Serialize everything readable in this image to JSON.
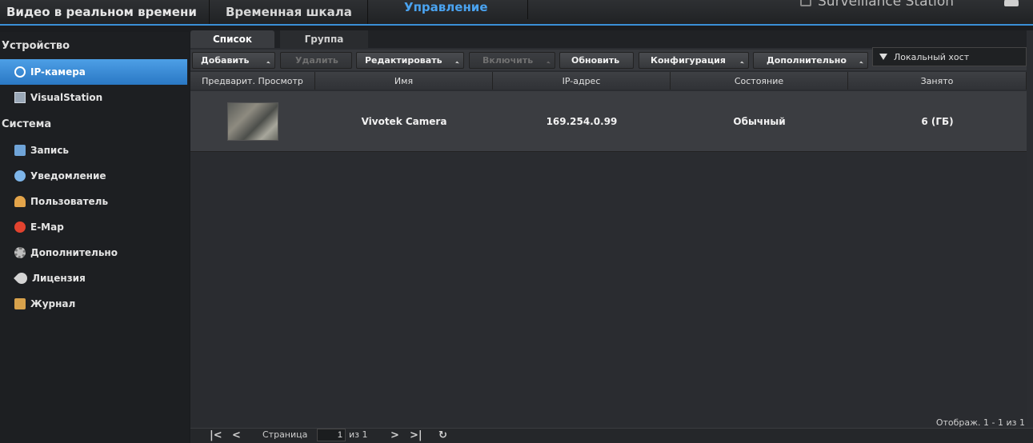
{
  "top_nav": {
    "live_view": "Видео в реальном времени",
    "timeline": "Временная шкала",
    "management": "Управление",
    "brand": "Surveillance Station"
  },
  "sidebar": {
    "device_section": "Устройство",
    "system_section": "Система",
    "device_items": [
      {
        "label": "IP-камера",
        "icon": "camera-icon"
      },
      {
        "label": "VisualStation",
        "icon": "visualstation-icon"
      }
    ],
    "system_items": [
      {
        "label": "Запись",
        "icon": "recording-icon"
      },
      {
        "label": "Уведомление",
        "icon": "notification-icon"
      },
      {
        "label": "Пользователь",
        "icon": "user-icon"
      },
      {
        "label": "E-Map",
        "icon": "emap-icon"
      },
      {
        "label": "Дополнительно",
        "icon": "advanced-icon"
      },
      {
        "label": "Лицензия",
        "icon": "license-icon"
      },
      {
        "label": "Журнал",
        "icon": "log-icon"
      }
    ]
  },
  "tabs": {
    "list": "Список",
    "group": "Группа"
  },
  "toolbar": {
    "add": "Добавить",
    "delete": "Удалить",
    "edit": "Редактировать",
    "enable": "Включить",
    "refresh": "Обновить",
    "configuration": "Конфигурация",
    "more": "Дополнительно",
    "filter": "Локальный хост"
  },
  "table": {
    "headers": {
      "preview": "Предварит. Просмотр",
      "name": "Имя",
      "ip": "IP-адрес",
      "status": "Состояние",
      "used": "Занято"
    },
    "rows": [
      {
        "name": "Vivotek Camera",
        "ip": "169.254.0.99",
        "status": "Обычный",
        "used": "6 (ГБ)"
      }
    ]
  },
  "pager": {
    "page_label": "Страница",
    "page_value": "1",
    "of_label": "из 1",
    "display": "Отображ. 1 - 1 из 1"
  }
}
